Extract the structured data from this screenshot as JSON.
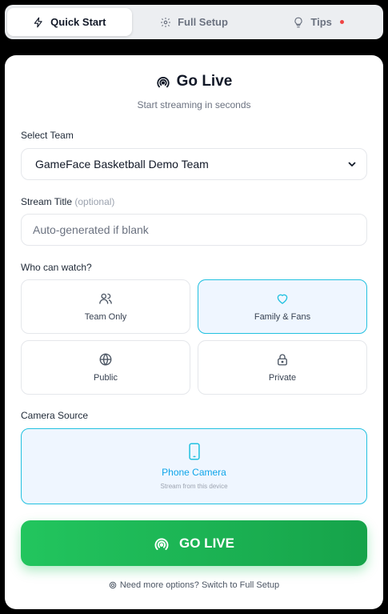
{
  "tabs": [
    {
      "label": "Quick Start",
      "icon": "lightning-icon",
      "active": true
    },
    {
      "label": "Full Setup",
      "icon": "gear-icon",
      "active": false
    },
    {
      "label": "Tips",
      "icon": "lightbulb-icon",
      "active": false
    }
  ],
  "header": {
    "title": "Go Live",
    "subtitle": "Start streaming in seconds"
  },
  "team": {
    "label": "Select Team",
    "selected": "GameFace Basketball Demo Team"
  },
  "stream_title": {
    "label": "Stream Title",
    "optional": "(optional)",
    "placeholder": "Auto-generated if blank",
    "value": ""
  },
  "audience": {
    "label": "Who can watch?",
    "options": [
      {
        "label": "Team Only",
        "icon": "users-icon",
        "selected": false
      },
      {
        "label": "Family & Fans",
        "icon": "heart-icon",
        "selected": true
      },
      {
        "label": "Public",
        "icon": "globe-icon",
        "selected": false
      },
      {
        "label": "Private",
        "icon": "lock-icon",
        "selected": false
      }
    ]
  },
  "camera": {
    "label": "Camera Source",
    "title": "Phone Camera",
    "subtitle": "Stream from this device",
    "icon": "smartphone-icon"
  },
  "cta": {
    "label": "GO LIVE",
    "icon": "broadcast-icon"
  },
  "footer": {
    "text": "Need more options? Switch to Full Setup"
  },
  "colors": {
    "accent": "#22c1e0",
    "primary": "#22c55e",
    "selected_bg": "#eff6ff",
    "alert_dot": "#ef4444"
  }
}
